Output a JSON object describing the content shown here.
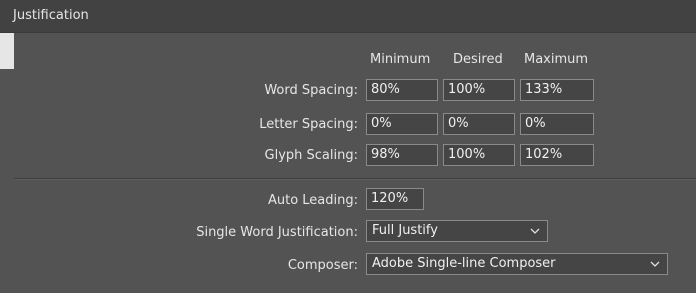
{
  "panel": {
    "title": "Justification"
  },
  "columns": {
    "minimum": "Minimum",
    "desired": "Desired",
    "maximum": "Maximum"
  },
  "rows": [
    {
      "label": "Word Spacing:",
      "minimum": "80%",
      "desired": "100%",
      "maximum": "133%"
    },
    {
      "label": "Letter Spacing:",
      "minimum": "0%",
      "desired": "0%",
      "maximum": "0%"
    },
    {
      "label": "Glyph Scaling:",
      "minimum": "98%",
      "desired": "100%",
      "maximum": "102%"
    }
  ],
  "auto_leading": {
    "label": "Auto Leading:",
    "value": "120%"
  },
  "single_word_justification": {
    "label": "Single Word Justification:",
    "value": "Full Justify"
  },
  "composer": {
    "label": "Composer:",
    "value": "Adobe Single-line Composer"
  },
  "icons": {
    "dropdown": "chevron-down-icon"
  }
}
